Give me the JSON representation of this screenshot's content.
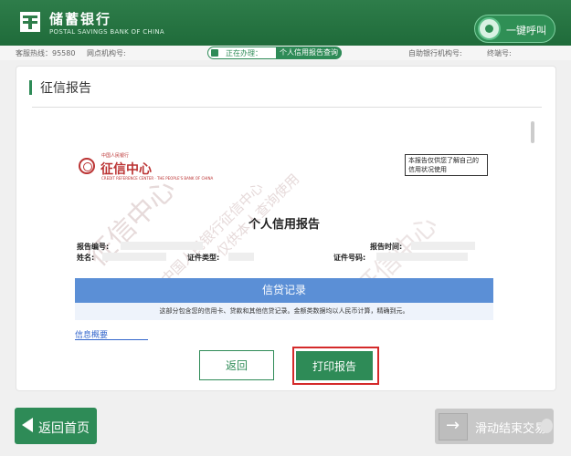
{
  "header": {
    "bank_name_cn": "储蓄银行",
    "bank_name_en": "POSTAL SAVINGS BANK OF CHINA",
    "call_button_label": "一键呼叫"
  },
  "infobar": {
    "hotline": "客服热线：95580",
    "branch_label": "网点机构号:",
    "processing_label": "正在办理：",
    "processing_value": "个人信用报告查询",
    "atm_label": "自助银行机构号:",
    "terminal_label": "终端号:"
  },
  "panel": {
    "title": "征信报告"
  },
  "report": {
    "org_top": "中国人民银行",
    "org_name": "征信中心",
    "org_en": "CREDIT REFERENCE CENTER · THE PEOPLE'S BANK OF CHINA",
    "notice": "本报告仅供您了解自己的信用状况使用",
    "title": "个人信用报告",
    "report_no_label": "报告编号:",
    "report_time_label": "报告时间:",
    "name_label": "姓名:",
    "id_type_label": "证件类型:",
    "id_no_label": "证件号码:",
    "credit_section": "信贷记录",
    "credit_note": "这部分包含您的信用卡、贷款和其他信贷记录。金额类数据均以人民币计算，精确到元。",
    "overview": "信息概要",
    "watermark_main": "征信中心",
    "watermark_sub": "中国人民银行征信中心",
    "watermark_side": "仅供本人查询使用"
  },
  "buttons": {
    "back": "返回",
    "print": "打印报告",
    "home": "返回首页",
    "slide_end": "滑动结束交易"
  }
}
